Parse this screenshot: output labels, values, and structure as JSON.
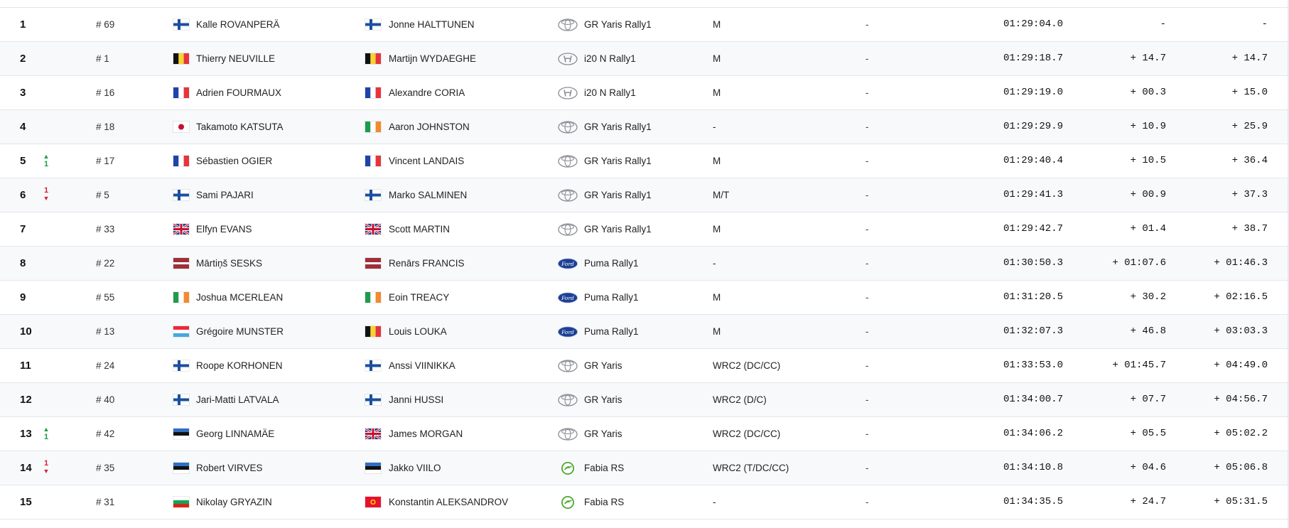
{
  "results": [
    {
      "pos": "1",
      "car": "# 69",
      "driver": "Kalle ROVANPERÄ",
      "driver_flag": "fi-flag-icon",
      "codriver": "Jonne HALTTUNEN",
      "codriver_flag": "fi-flag-icon",
      "brand": "toyota-logo-icon",
      "model": "GR Yaris Rally1",
      "class": "M",
      "penalty": "-",
      "time": "01:29:04.0",
      "gap_prev": "-",
      "gap_first": "-",
      "change": null
    },
    {
      "pos": "2",
      "car": "# 1",
      "driver": "Thierry NEUVILLE",
      "driver_flag": "be-flag-icon",
      "codriver": "Martijn WYDAEGHE",
      "codriver_flag": "be-flag-icon",
      "brand": "hyundai-logo-icon",
      "model": "i20 N Rally1",
      "class": "M",
      "penalty": "-",
      "time": "01:29:18.7",
      "gap_prev": "+ 14.7",
      "gap_first": "+ 14.7",
      "change": null
    },
    {
      "pos": "3",
      "car": "# 16",
      "driver": "Adrien FOURMAUX",
      "driver_flag": "fr-flag-icon",
      "codriver": "Alexandre CORIA",
      "codriver_flag": "fr-flag-icon",
      "brand": "hyundai-logo-icon",
      "model": "i20 N Rally1",
      "class": "M",
      "penalty": "-",
      "time": "01:29:19.0",
      "gap_prev": "+ 00.3",
      "gap_first": "+ 15.0",
      "change": null
    },
    {
      "pos": "4",
      "car": "# 18",
      "driver": "Takamoto KATSUTA",
      "driver_flag": "jp-flag-icon",
      "codriver": "Aaron JOHNSTON",
      "codriver_flag": "ie-flag-icon",
      "brand": "toyota-logo-icon",
      "model": "GR Yaris Rally1",
      "class": "-",
      "penalty": "-",
      "time": "01:29:29.9",
      "gap_prev": "+ 10.9",
      "gap_first": "+ 25.9",
      "change": null
    },
    {
      "pos": "5",
      "car": "# 17",
      "driver": "Sébastien OGIER",
      "driver_flag": "fr-flag-icon",
      "codriver": "Vincent LANDAIS",
      "codriver_flag": "fr-flag-icon",
      "brand": "toyota-logo-icon",
      "model": "GR Yaris Rally1",
      "class": "M",
      "penalty": "-",
      "time": "01:29:40.4",
      "gap_prev": "+ 10.5",
      "gap_first": "+ 36.4",
      "change": {
        "dir": "up",
        "num": "1"
      }
    },
    {
      "pos": "6",
      "car": "# 5",
      "driver": "Sami PAJARI",
      "driver_flag": "fi-flag-icon",
      "codriver": "Marko SALMINEN",
      "codriver_flag": "fi-flag-icon",
      "brand": "toyota-logo-icon",
      "model": "GR Yaris Rally1",
      "class": "M/T",
      "penalty": "-",
      "time": "01:29:41.3",
      "gap_prev": "+ 00.9",
      "gap_first": "+ 37.3",
      "change": {
        "dir": "down",
        "num": "1"
      }
    },
    {
      "pos": "7",
      "car": "# 33",
      "driver": "Elfyn EVANS",
      "driver_flag": "gb-flag-icon",
      "codriver": "Scott MARTIN",
      "codriver_flag": "gb-flag-icon",
      "brand": "toyota-logo-icon",
      "model": "GR Yaris Rally1",
      "class": "M",
      "penalty": "-",
      "time": "01:29:42.7",
      "gap_prev": "+ 01.4",
      "gap_first": "+ 38.7",
      "change": null
    },
    {
      "pos": "8",
      "car": "# 22",
      "driver": "Mārtiņš SESKS",
      "driver_flag": "lv-flag-icon",
      "codriver": "Renārs FRANCIS",
      "codriver_flag": "lv-flag-icon",
      "brand": "ford-logo-icon",
      "model": "Puma Rally1",
      "class": "-",
      "penalty": "-",
      "time": "01:30:50.3",
      "gap_prev": "+ 01:07.6",
      "gap_first": "+ 01:46.3",
      "change": null
    },
    {
      "pos": "9",
      "car": "# 55",
      "driver": "Joshua MCERLEAN",
      "driver_flag": "ie-flag-icon",
      "codriver": "Eoin TREACY",
      "codriver_flag": "ie-flag-icon",
      "brand": "ford-logo-icon",
      "model": "Puma Rally1",
      "class": "M",
      "penalty": "-",
      "time": "01:31:20.5",
      "gap_prev": "+ 30.2",
      "gap_first": "+ 02:16.5",
      "change": null
    },
    {
      "pos": "10",
      "car": "# 13",
      "driver": "Grégoire MUNSTER",
      "driver_flag": "lu-flag-icon",
      "codriver": "Louis LOUKA",
      "codriver_flag": "be-flag-icon",
      "brand": "ford-logo-icon",
      "model": "Puma Rally1",
      "class": "M",
      "penalty": "-",
      "time": "01:32:07.3",
      "gap_prev": "+ 46.8",
      "gap_first": "+ 03:03.3",
      "change": null
    },
    {
      "pos": "11",
      "car": "# 24",
      "driver": "Roope KORHONEN",
      "driver_flag": "fi-flag-icon",
      "codriver": "Anssi VIINIKKA",
      "codriver_flag": "fi-flag-icon",
      "brand": "toyota-logo-icon",
      "model": "GR Yaris",
      "class": "WRC2 (DC/CC)",
      "penalty": "-",
      "time": "01:33:53.0",
      "gap_prev": "+ 01:45.7",
      "gap_first": "+ 04:49.0",
      "change": null
    },
    {
      "pos": "12",
      "car": "# 40",
      "driver": "Jari-Matti LATVALA",
      "driver_flag": "fi-flag-icon",
      "codriver": "Janni HUSSI",
      "codriver_flag": "fi-flag-icon",
      "brand": "toyota-logo-icon",
      "model": "GR Yaris",
      "class": "WRC2 (D/C)",
      "penalty": "-",
      "time": "01:34:00.7",
      "gap_prev": "+ 07.7",
      "gap_first": "+ 04:56.7",
      "change": null
    },
    {
      "pos": "13",
      "car": "# 42",
      "driver": "Georg LINNAMÄE",
      "driver_flag": "ee-flag-icon",
      "codriver": "James MORGAN",
      "codriver_flag": "gb-flag-icon",
      "brand": "toyota-logo-icon",
      "model": "GR Yaris",
      "class": "WRC2 (DC/CC)",
      "penalty": "-",
      "time": "01:34:06.2",
      "gap_prev": "+ 05.5",
      "gap_first": "+ 05:02.2",
      "change": {
        "dir": "up",
        "num": "1"
      }
    },
    {
      "pos": "14",
      "car": "# 35",
      "driver": "Robert VIRVES",
      "driver_flag": "ee-flag-icon",
      "codriver": "Jakko VIILO",
      "codriver_flag": "ee-flag-icon",
      "brand": "skoda-logo-icon",
      "model": "Fabia RS",
      "class": "WRC2 (T/DC/CC)",
      "penalty": "-",
      "time": "01:34:10.8",
      "gap_prev": "+ 04.6",
      "gap_first": "+ 05:06.8",
      "change": {
        "dir": "down",
        "num": "1"
      }
    },
    {
      "pos": "15",
      "car": "# 31",
      "driver": "Nikolay GRYAZIN",
      "driver_flag": "bg-flag-icon",
      "codriver": "Konstantin ALEKSANDROV",
      "codriver_flag": "kg-flag-icon",
      "brand": "skoda-logo-icon",
      "model": "Fabia RS",
      "class": "-",
      "penalty": "-",
      "time": "01:34:35.5",
      "gap_prev": "+ 24.7",
      "gap_first": "+ 05:31.5",
      "change": null
    }
  ],
  "colors": {
    "up": "#1a9b46",
    "down": "#d0243b",
    "row_alt": "#f8f9fb",
    "border": "#e4e6ea"
  }
}
